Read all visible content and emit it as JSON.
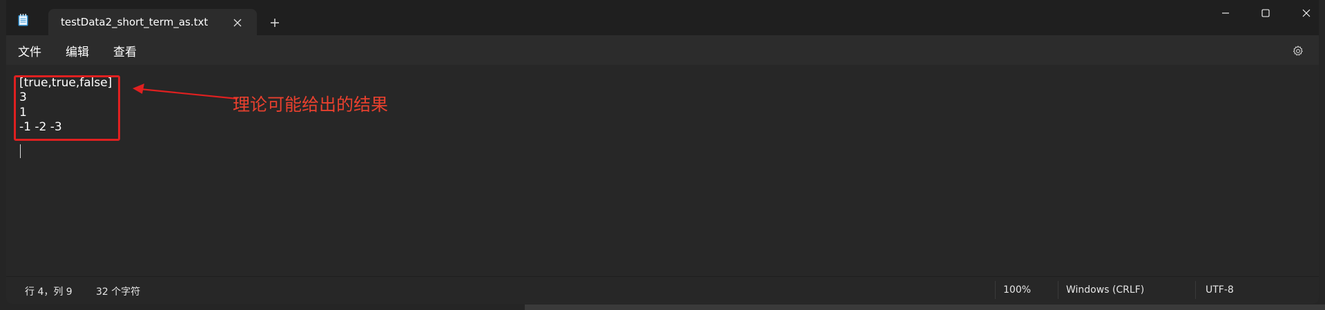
{
  "window": {
    "tab_title": "testData2_short_term_as.txt",
    "add_tab_glyph": "+"
  },
  "menu": {
    "items": [
      "文件",
      "编辑",
      "查看"
    ]
  },
  "editor": {
    "lines": [
      "[true,true,false]",
      "3",
      "1",
      "-1 -2 -3"
    ]
  },
  "annotation": {
    "text": "理论可能给出的结果",
    "color": "#e02020"
  },
  "status": {
    "position": "行 4，列 9",
    "char_count": "32 个字符",
    "zoom": "100%",
    "line_ending": "Windows (CRLF)",
    "encoding": "UTF-8"
  },
  "icons": {
    "app": "notepad-icon",
    "close_tab": "close-icon",
    "minimize": "minimize-icon",
    "maximize": "maximize-icon",
    "close_window": "close-window-icon",
    "settings": "gear-icon"
  }
}
